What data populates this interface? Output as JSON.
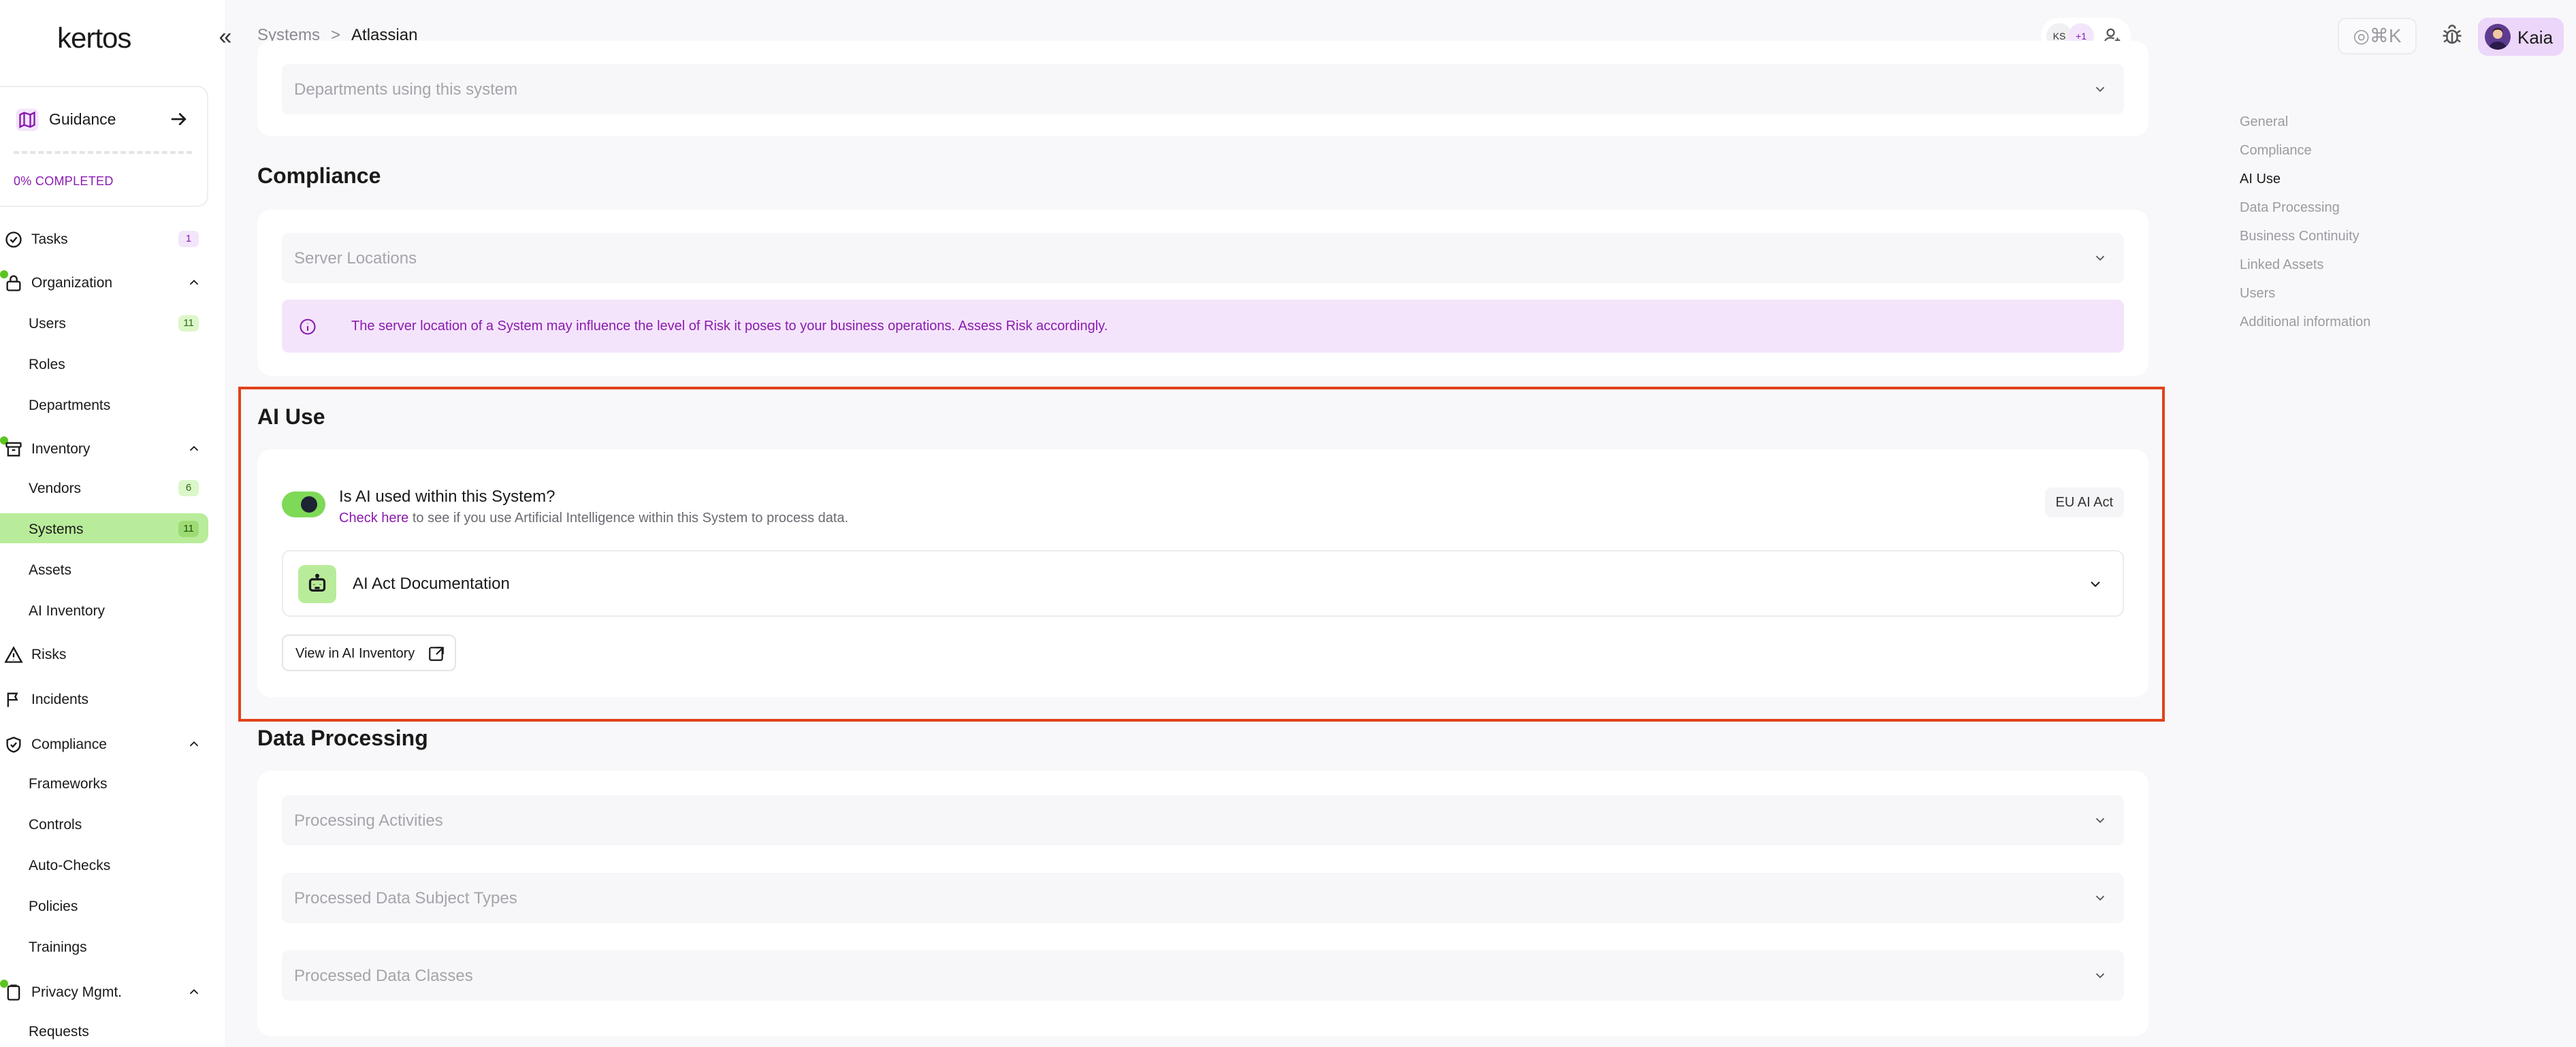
{
  "app": {
    "logo": "kertos"
  },
  "sidebar": {
    "collapse_icon": "double-chevron-left-icon",
    "guidance": {
      "label": "Guidance",
      "progress_percent": 0,
      "completed_text": "0% COMPLETED"
    },
    "items": {
      "tasks": {
        "label": "Tasks",
        "count": "1"
      },
      "organization": {
        "label": "Organization"
      },
      "users": {
        "label": "Users",
        "count": "11"
      },
      "roles": {
        "label": "Roles"
      },
      "departments": {
        "label": "Departments"
      },
      "inventory": {
        "label": "Inventory"
      },
      "vendors": {
        "label": "Vendors",
        "count": "6"
      },
      "systems": {
        "label": "Systems",
        "count": "11"
      },
      "assets": {
        "label": "Assets"
      },
      "ai_inventory": {
        "label": "AI Inventory"
      },
      "risks": {
        "label": "Risks"
      },
      "incidents": {
        "label": "Incidents"
      },
      "compliance": {
        "label": "Compliance"
      },
      "frameworks": {
        "label": "Frameworks"
      },
      "controls": {
        "label": "Controls"
      },
      "auto_checks": {
        "label": "Auto-Checks"
      },
      "policies": {
        "label": "Policies"
      },
      "trainings": {
        "label": "Trainings"
      },
      "privacy": {
        "label": "Privacy Mgmt."
      },
      "requests": {
        "label": "Requests"
      }
    }
  },
  "header": {
    "breadcrumb": {
      "parent": "Systems",
      "separator": ">",
      "current": "Atlassian"
    },
    "assignees": {
      "initials": "KS",
      "more": "+1"
    },
    "command": {
      "label": "⌘K"
    },
    "user": {
      "name": "Kaia"
    }
  },
  "main": {
    "departments_accordion": "Departments using this system",
    "compliance": {
      "title": "Compliance",
      "server_locations": "Server Locations",
      "info_text": "The server location of a System may influence the level of Risk it poses to your business operations. Assess Risk accordingly."
    },
    "ai_use": {
      "title": "AI Use",
      "toggle_on": true,
      "question": "Is AI used within this System?",
      "check_link": "Check here",
      "check_text": " to see if you use Artificial Intelligence within this System to process data.",
      "badge": "EU AI Act",
      "documentation": "AI Act Documentation",
      "view_button": "View in AI Inventory"
    },
    "data_processing": {
      "title": "Data Processing",
      "items": [
        "Processing Activities",
        "Processed Data Subject Types",
        "Processed Data Classes"
      ]
    }
  },
  "toc": {
    "items": [
      "General",
      "Compliance",
      "AI Use",
      "Data Processing",
      "Business Continuity",
      "Linked Assets",
      "Users",
      "Additional information"
    ],
    "active": "AI Use"
  },
  "colors": {
    "accent_purple": "#8a1bb0",
    "active_green": "#b8ec9a",
    "toggle_green": "#7ed957",
    "highlight_red": "#e0421a",
    "info_bg": "#f4e4fb"
  }
}
